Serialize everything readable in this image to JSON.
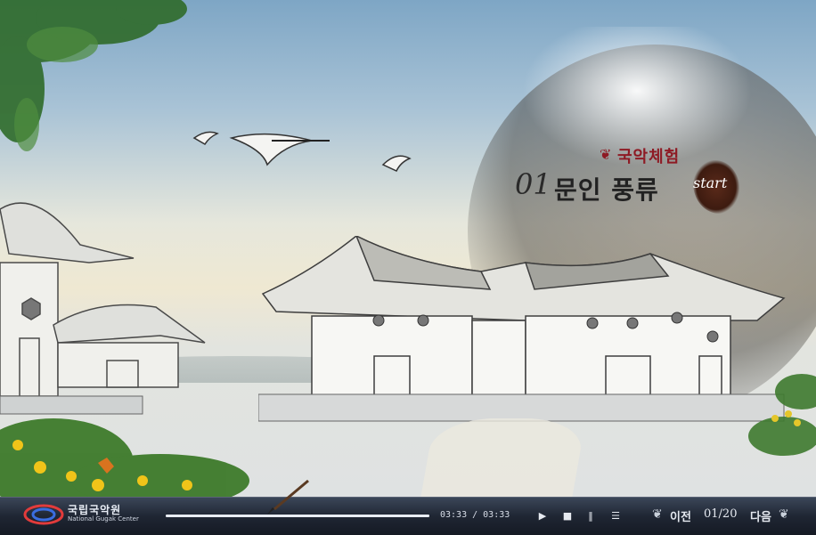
{
  "scene": {
    "subtitle": "국악체험",
    "number": "01",
    "title": "문인 풍류",
    "start_label": "start"
  },
  "player": {
    "logo_kr": "국립국악원",
    "logo_en": "National Gugak Center",
    "time": "03:33 / 03:33",
    "progress": 1.0,
    "play_icon": "play-icon",
    "stop_icon": "stop-icon",
    "pause_icon": "pause-icon",
    "menu_icon": "menu-icon"
  },
  "pager": {
    "prev_label": "이전",
    "current": "01/20",
    "next_label": "다음"
  },
  "colors": {
    "accent_red": "#8e1a24",
    "bar_bg": "#1f2633"
  }
}
